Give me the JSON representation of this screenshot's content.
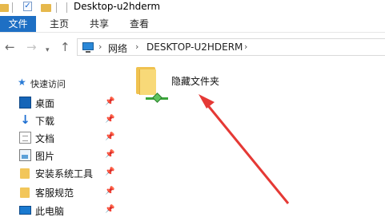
{
  "window": {
    "title": "Desktop-u2hderm"
  },
  "ribbon": {
    "tabs": [
      "文件",
      "主页",
      "共享",
      "查看"
    ]
  },
  "address": {
    "crumbs": [
      "网络",
      "DESKTOP-U2HDERM"
    ]
  },
  "sidebar": {
    "quick_access": "快速访问",
    "items": [
      {
        "label": "桌面",
        "icon": "desktop-icon",
        "pinned": true
      },
      {
        "label": "下载",
        "icon": "download-icon",
        "pinned": true
      },
      {
        "label": "文档",
        "icon": "document-icon",
        "pinned": true
      },
      {
        "label": "图片",
        "icon": "pictures-icon",
        "pinned": true
      },
      {
        "label": "安装系统工具",
        "icon": "folder-icon",
        "pinned": true
      },
      {
        "label": "客服规范",
        "icon": "folder-icon",
        "pinned": true
      },
      {
        "label": "此电脑",
        "icon": "this-pc-icon",
        "pinned": true
      }
    ]
  },
  "content": {
    "items": [
      {
        "label": "隐藏文件夹",
        "icon": "shared-folder-icon"
      }
    ]
  },
  "colors": {
    "file_tab": "#1e6fc4",
    "annotation_arrow": "#e53935",
    "folder": "#f0c24f"
  }
}
